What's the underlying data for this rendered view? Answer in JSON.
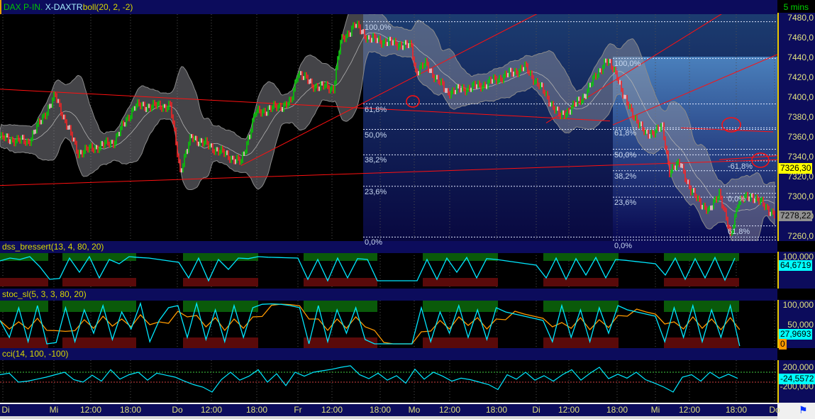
{
  "header": {
    "instrument": "DAX P-IN.",
    "symbol": "X-DAXTR",
    "study": "boll(20, 2, -2)",
    "interval": "5 mins"
  },
  "panels": {
    "dss": {
      "label": "dss_bressert(13, 4, 80, 20)",
      "axis": [
        "100,000"
      ],
      "current": "64,6719"
    },
    "stoc": {
      "label": "stoc_sl(5, 3, 3, 80, 20)",
      "axis": [
        "100,000",
        "50,000"
      ],
      "current": "27,9693",
      "current2": "0"
    },
    "cci": {
      "label": "cci(14, 100, -100)",
      "axis": [
        "200,000",
        "-200,000"
      ],
      "current": "-24,5572"
    }
  },
  "price_axis": [
    "7480,0",
    "7460,0",
    "7440,0",
    "7420,0",
    "7400,0",
    "7380,0",
    "7360,0",
    "7340,0",
    "7320,0",
    "7300,0",
    "7280,0",
    "7260,0"
  ],
  "price_tags": {
    "last": "7326,30",
    "other": "7278,22"
  },
  "colors": {
    "up": "#00d000",
    "down": "#ff2020",
    "neutral": "#ffd0d0",
    "osc": "#00e8ff",
    "osc2": "#ff9a00",
    "trend": "#ff1010",
    "axis_text": "#e0e080"
  },
  "chart_data": {
    "type": "line",
    "title": "DAX P-IN. X-DAXTR boll(20, 2, -2)",
    "interval": "5 mins",
    "ylim": [
      7255,
      7483
    ],
    "x_ticks": [
      {
        "label": "Di",
        "t": 2
      },
      {
        "label": "Mi",
        "t": 38
      },
      {
        "label": "12:00",
        "t": 64
      },
      {
        "label": "18:00",
        "t": 92
      },
      {
        "label": "Do",
        "t": 125
      },
      {
        "label": "12:00",
        "t": 149
      },
      {
        "label": "18:00",
        "t": 181
      },
      {
        "label": "Fr",
        "t": 210
      },
      {
        "label": "12:00",
        "t": 234
      },
      {
        "label": "18:00",
        "t": 268
      },
      {
        "label": "Mo",
        "t": 292
      },
      {
        "label": "12:00",
        "t": 317
      },
      {
        "label": "18:00",
        "t": 350
      },
      {
        "label": "Di",
        "t": 378
      },
      {
        "label": "12:00",
        "t": 401
      },
      {
        "label": "18:00",
        "t": 435
      },
      {
        "label": "Mi",
        "t": 462
      },
      {
        "label": "12:00",
        "t": 486
      },
      {
        "label": "18:00",
        "t": 519
      },
      {
        "label": "Do",
        "t": 546
      }
    ],
    "price": [
      [
        0,
        7359
      ],
      [
        20,
        7355
      ],
      [
        39,
        7401
      ],
      [
        55,
        7344
      ],
      [
        80,
        7355
      ],
      [
        95,
        7391
      ],
      [
        120,
        7391
      ],
      [
        127,
        7326
      ],
      [
        135,
        7360
      ],
      [
        170,
        7334
      ],
      [
        180,
        7384
      ],
      [
        205,
        7394
      ],
      [
        210,
        7426
      ],
      [
        220,
        7412
      ],
      [
        235,
        7409
      ],
      [
        240,
        7455
      ],
      [
        250,
        7473
      ],
      [
        260,
        7459
      ],
      [
        290,
        7451
      ],
      [
        293,
        7426
      ],
      [
        300,
        7433
      ],
      [
        315,
        7405
      ],
      [
        340,
        7412
      ],
      [
        370,
        7430
      ],
      [
        380,
        7412
      ],
      [
        395,
        7380
      ],
      [
        410,
        7398
      ],
      [
        427,
        7437
      ],
      [
        435,
        7423
      ],
      [
        440,
        7398
      ],
      [
        455,
        7362
      ],
      [
        467,
        7369
      ],
      [
        472,
        7326
      ],
      [
        480,
        7333
      ],
      [
        487,
        7305
      ],
      [
        500,
        7284
      ],
      [
        507,
        7305
      ],
      [
        515,
        7259
      ],
      [
        520,
        7294
      ],
      [
        530,
        7301
      ],
      [
        546,
        7282
      ]
    ],
    "fibonacci": [
      {
        "t0": 256,
        "t1": 548,
        "high": 7476,
        "low": 7259,
        "levels": [
          {
            "label": "100,0%",
            "r": 1
          },
          {
            "label": "61,8%",
            "r": 0.618
          },
          {
            "label": "50,0%",
            "r": 0.5
          },
          {
            "label": "38,2%",
            "r": 0.382
          },
          {
            "label": "23,6%",
            "r": 0.236
          },
          {
            "label": "0,0%",
            "r": 0
          }
        ]
      },
      {
        "t0": 432,
        "t1": 548,
        "high": 7439,
        "low": 7256,
        "levels": [
          {
            "label": "100,0%",
            "r": 1
          },
          {
            "label": "61,8%",
            "r": 0.618
          },
          {
            "label": "50,0%",
            "r": 0.5
          },
          {
            "label": "38,2%",
            "r": 0.382
          },
          {
            "label": "23,6%",
            "r": 0.236
          },
          {
            "label": "0,0%",
            "r": 0
          }
        ]
      },
      {
        "t0": 512,
        "t1": 548,
        "high": 7250,
        "low": 7303,
        "levels": [
          {
            "label": "-61,8%",
            "r": -0.618
          },
          {
            "label": "0,0%",
            "r": 0
          },
          {
            "label": "61,8%",
            "r": 0.618
          }
        ]
      }
    ],
    "trendlines": [
      [
        0,
        7408,
        430,
        7376
      ],
      [
        0,
        7311,
        548,
        7337
      ],
      [
        170,
        7331,
        380,
        7485
      ],
      [
        385,
        7374,
        510,
        7485
      ],
      [
        432,
        7372,
        548,
        7443
      ],
      [
        480,
        7369,
        545,
        7365
      ],
      [
        507,
        7337,
        548,
        7341
      ]
    ],
    "sessions": [
      [
        0,
        34
      ],
      [
        44,
        96
      ],
      [
        129,
        182
      ],
      [
        214,
        266
      ],
      [
        298,
        351
      ],
      [
        383,
        436
      ],
      [
        468,
        521
      ]
    ],
    "dss": [
      80,
      90,
      85,
      95,
      60,
      15,
      18,
      90,
      40,
      95,
      20,
      85,
      70,
      95,
      92,
      90,
      85,
      80,
      75,
      20,
      90,
      10,
      85,
      50,
      90,
      88,
      95,
      93,
      92,
      91,
      90,
      15,
      85,
      10,
      90,
      20,
      88,
      85,
      10,
      10,
      10,
      10,
      10,
      85,
      15,
      90,
      40,
      92,
      20,
      88,
      85,
      80,
      75,
      70,
      65,
      20,
      90,
      15,
      88,
      30,
      92,
      20,
      85,
      82,
      78,
      74,
      70,
      30,
      90,
      15,
      88,
      20,
      92,
      12,
      90
    ],
    "stoc": [
      60,
      20,
      90,
      10,
      95,
      5,
      8,
      90,
      10,
      85,
      30,
      95,
      15,
      80,
      40,
      100,
      10,
      60,
      90,
      95,
      20,
      100,
      15,
      85,
      10,
      95,
      20,
      90,
      98,
      99,
      98,
      95,
      90,
      5,
      95,
      10,
      85,
      30,
      90,
      15,
      5,
      5,
      5,
      5,
      5,
      90,
      10,
      80,
      30,
      95,
      20,
      85,
      15,
      90,
      80,
      75,
      70,
      65,
      60,
      10,
      95,
      20,
      85,
      10,
      90,
      30,
      95,
      85,
      80,
      75,
      70,
      10,
      90,
      20,
      95,
      10,
      85,
      20,
      95,
      0
    ],
    "cci": [
      50,
      80,
      -100,
      -80,
      -40,
      0,
      50,
      100,
      -50,
      -100,
      40,
      -80,
      150,
      -40,
      50,
      100,
      -60,
      80,
      40,
      0,
      -80,
      -150,
      -200,
      -300,
      -50,
      100,
      -60,
      20,
      150,
      -100,
      70,
      -170,
      100,
      20,
      100,
      130,
      160,
      200,
      230,
      50,
      -30,
      80,
      -60,
      30,
      -120,
      160,
      -40,
      100,
      20,
      -80,
      -20,
      -50,
      -100,
      -150,
      -250,
      50,
      -40,
      100,
      -60,
      30,
      -80,
      50,
      150,
      -60,
      80,
      200,
      -30,
      60,
      -20,
      100,
      -50,
      -120,
      -200,
      -300,
      0,
      50,
      -80,
      100,
      -20,
      60,
      -24
    ]
  }
}
